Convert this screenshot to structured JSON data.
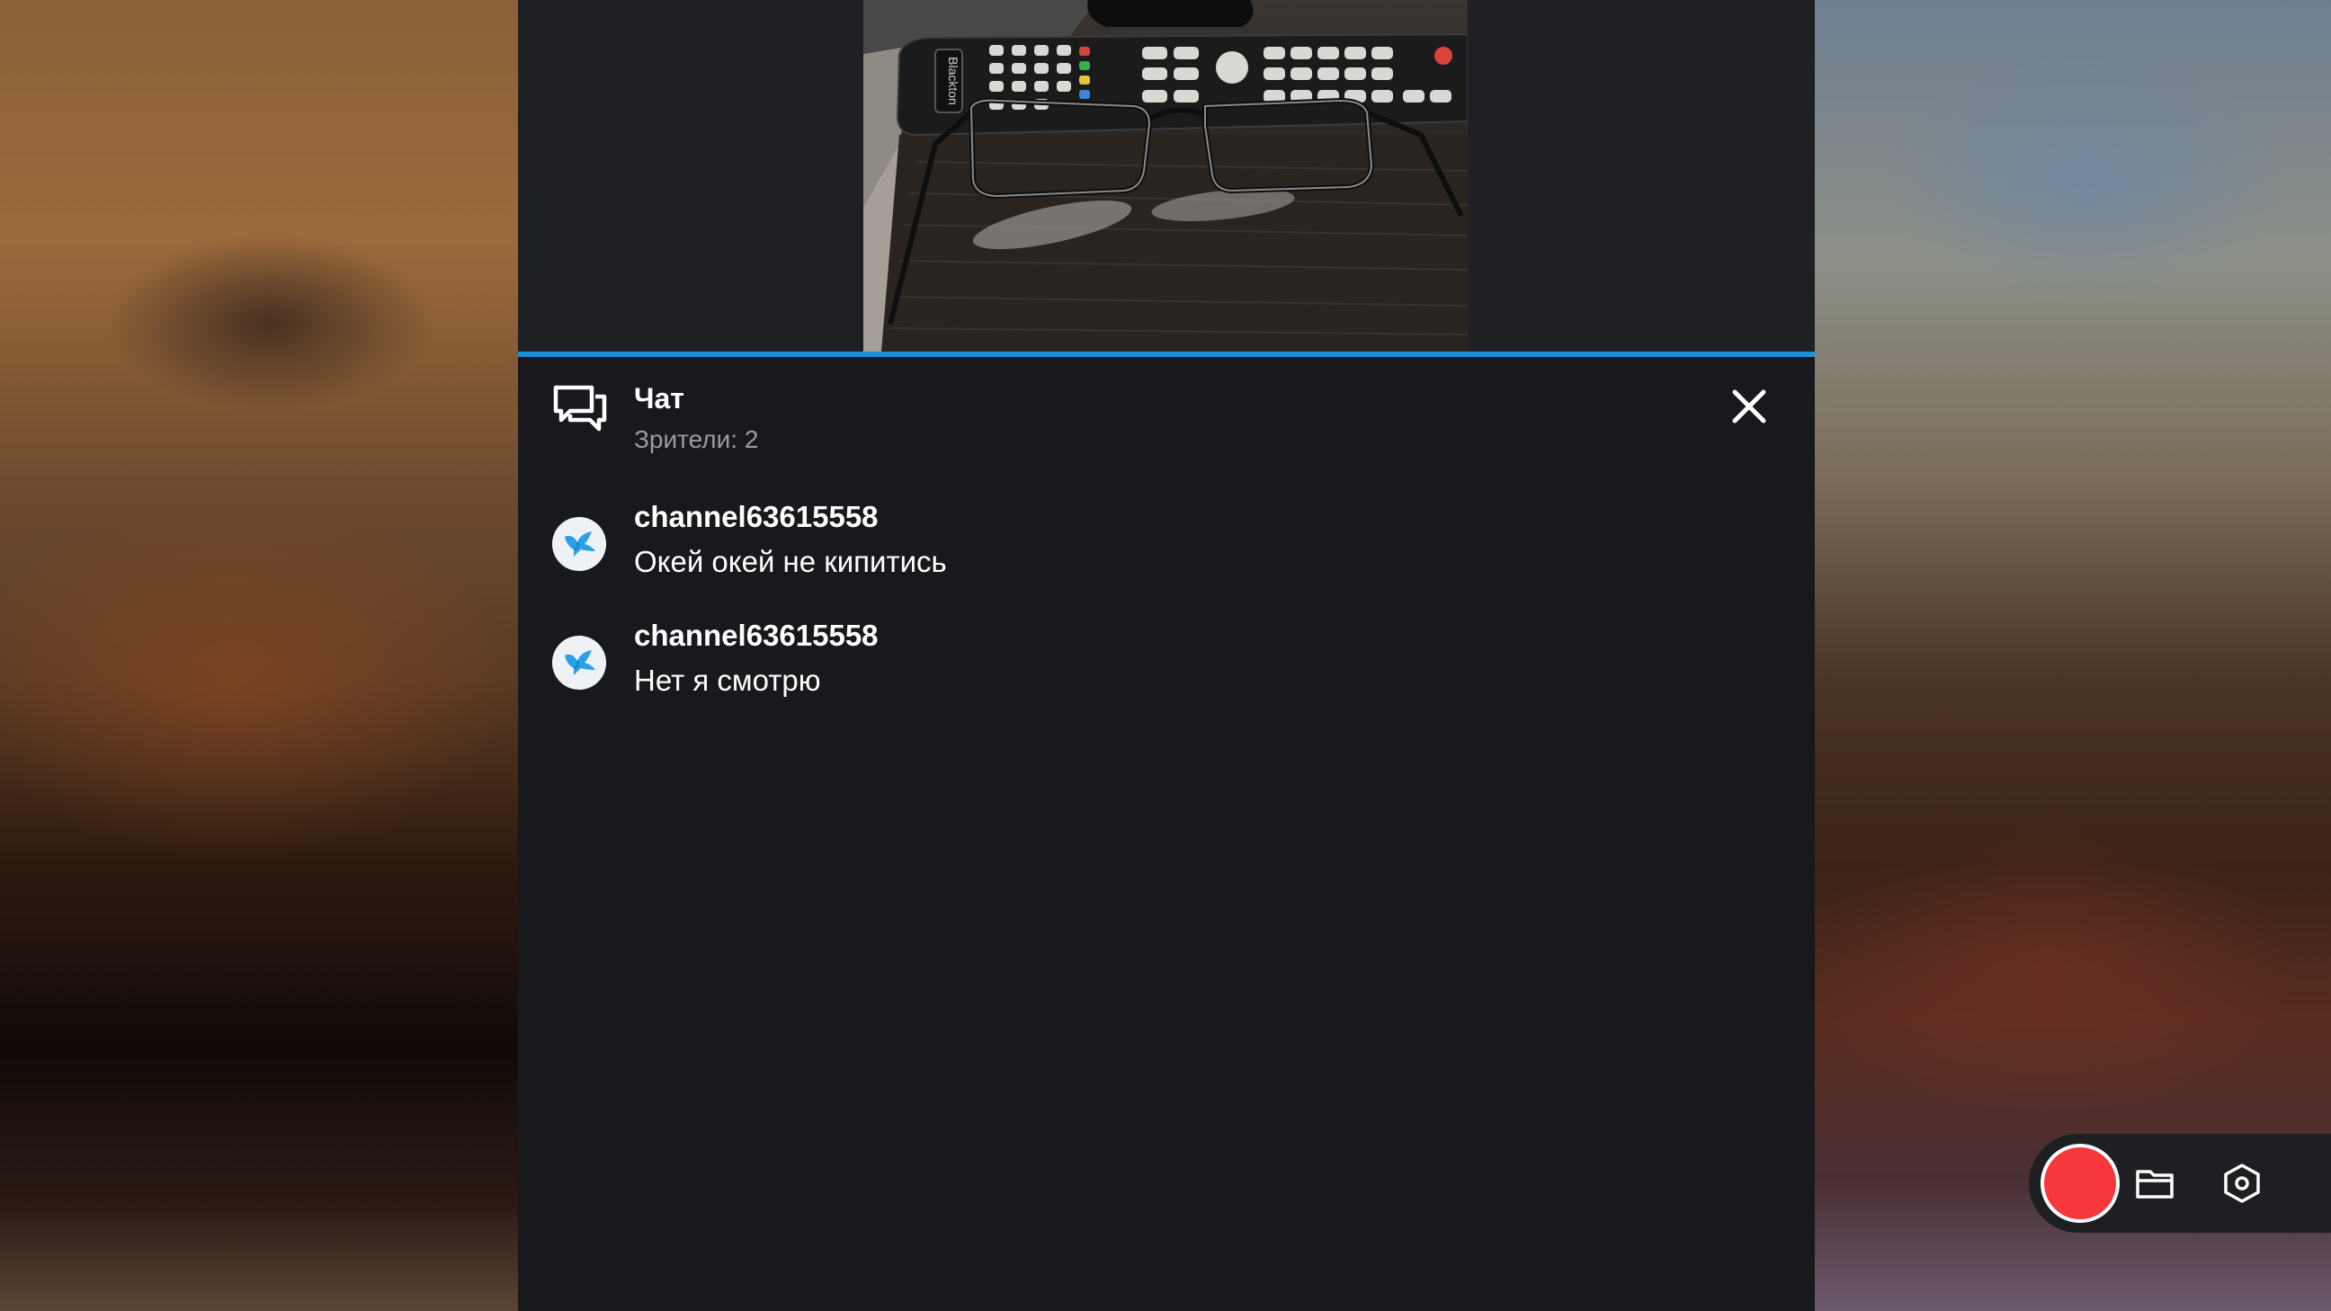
{
  "chat": {
    "title": "Чат",
    "viewers": "Зрители: 2",
    "icon": "chat-bubbles-icon",
    "close_icon": "close-icon"
  },
  "messages": [
    {
      "author": "channel63615558",
      "text": "Окей окей не кипитись",
      "avatar_icon": "bird-icon"
    },
    {
      "author": "channel63615558",
      "text": "Нет я смотрю",
      "avatar_icon": "bird-icon"
    }
  ],
  "video_preview": {
    "remote_brand_label": "Blackton"
  },
  "controls": {
    "record_icon": "record-icon",
    "files_icon": "folder-icon",
    "settings_icon": "settings-hexagon-icon"
  },
  "colors": {
    "accent": "#1a8fd8",
    "record": "#f6373b",
    "panel_bg": "#18191c",
    "text_primary": "#ffffff",
    "text_secondary": "#9a9ca1"
  }
}
